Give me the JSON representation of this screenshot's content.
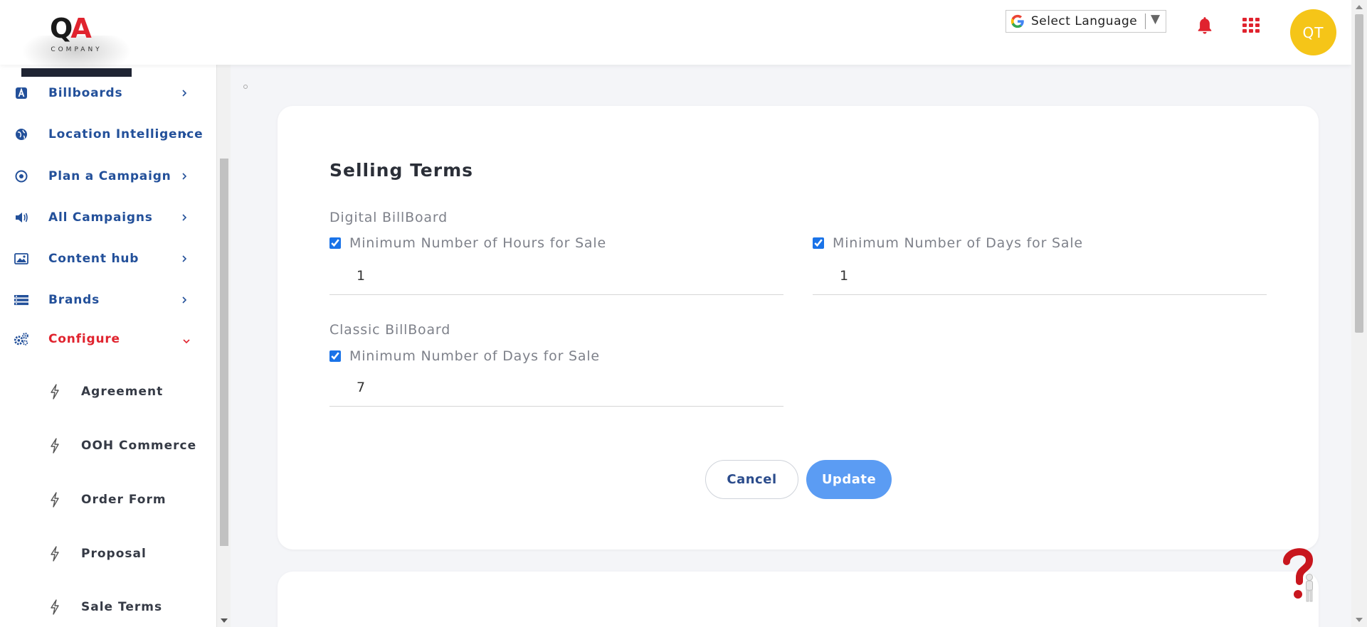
{
  "header": {
    "logo_text": "QA",
    "logo_sub": "COMPANY",
    "language_label": "Select Language",
    "language_caret": "▼",
    "avatar_initials": "QT"
  },
  "sidebar": {
    "items": [
      {
        "label": "Billboards",
        "icon": "billboard-icon"
      },
      {
        "label": "Location Intelligence",
        "icon": "globe-icon"
      },
      {
        "label": "Plan a Campaign",
        "icon": "target-icon"
      },
      {
        "label": "All Campaigns",
        "icon": "megaphone-icon"
      },
      {
        "label": "Content hub",
        "icon": "image-icon"
      },
      {
        "label": "Brands",
        "icon": "list-icon"
      },
      {
        "label": "Configure",
        "icon": "gears-icon",
        "expanded": true
      }
    ],
    "sub_items": [
      {
        "label": "Agreement"
      },
      {
        "label": "OOH Commerce"
      },
      {
        "label": "Order Form"
      },
      {
        "label": "Proposal"
      },
      {
        "label": "Sale Terms"
      }
    ]
  },
  "main": {
    "title": "Selling Terms",
    "digital": {
      "label": "Digital BillBoard",
      "hours_label": "Minimum Number of Hours for Sale",
      "hours_checked": true,
      "hours_value": "1",
      "days_label": "Minimum Number of Days for Sale",
      "days_checked": true,
      "days_value": "1"
    },
    "classic": {
      "label": "Classic BillBoard",
      "days_label": "Minimum Number of Days for Sale",
      "days_checked": true,
      "days_value": "7"
    },
    "cancel_label": "Cancel",
    "update_label": "Update"
  },
  "colors": {
    "accent": "#e0232e",
    "nav_blue": "#23509a",
    "update_blue": "#5b9cf3",
    "avatar_yellow": "#f5c518"
  }
}
